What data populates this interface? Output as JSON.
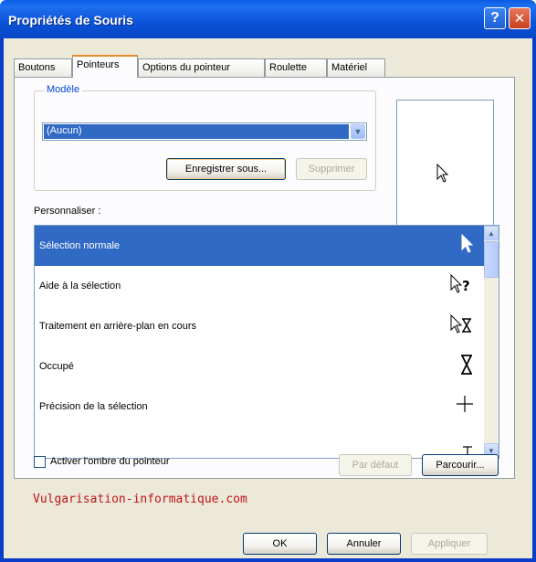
{
  "window": {
    "title": "Propriétés de Souris",
    "help_glyph": "?",
    "close_glyph": "✕"
  },
  "tabs": [
    {
      "label": "Boutons",
      "active": false
    },
    {
      "label": "Pointeurs",
      "active": true
    },
    {
      "label": "Options du pointeur",
      "active": false
    },
    {
      "label": "Roulette",
      "active": false
    },
    {
      "label": "Matériel",
      "active": false
    }
  ],
  "scheme": {
    "legend": "Modèle",
    "selected_value": "(Aucun)",
    "save_as_label": "Enregistrer sous...",
    "delete_label": "Supprimer"
  },
  "customize": {
    "label": "Personnaliser :",
    "items": [
      {
        "label": "Sélection normale",
        "icon": "arrow-pointer-icon",
        "glyph": "➤",
        "selected": true
      },
      {
        "label": "Aide à la sélection",
        "icon": "help-select-icon",
        "glyph": "⇱?",
        "selected": false
      },
      {
        "label": "Traitement en arrière-plan en cours",
        "icon": "working-in-background-icon",
        "glyph": "⇱⧗",
        "selected": false
      },
      {
        "label": "Occupé",
        "icon": "hourglass-icon",
        "glyph": "⧗",
        "selected": false
      },
      {
        "label": "Précision de la sélection",
        "icon": "crosshair-icon",
        "glyph": "+",
        "selected": false
      },
      {
        "label": "",
        "icon": "text-select-icon",
        "glyph": "Ɪ",
        "selected": false
      }
    ]
  },
  "shadow_checkbox": {
    "label": "Activer l'ombre du pointeur",
    "checked": false
  },
  "buttons": {
    "default_label": "Par défaut",
    "browse_label": "Parcourir...",
    "ok_label": "OK",
    "cancel_label": "Annuler",
    "apply_label": "Appliquer"
  },
  "watermark": "Vulgarisation-informatique.com",
  "colors": {
    "title_bar": "#0a52d8",
    "selection": "#316ac5",
    "dialog_bg": "#ece9d8",
    "watermark": "#c0141e"
  }
}
